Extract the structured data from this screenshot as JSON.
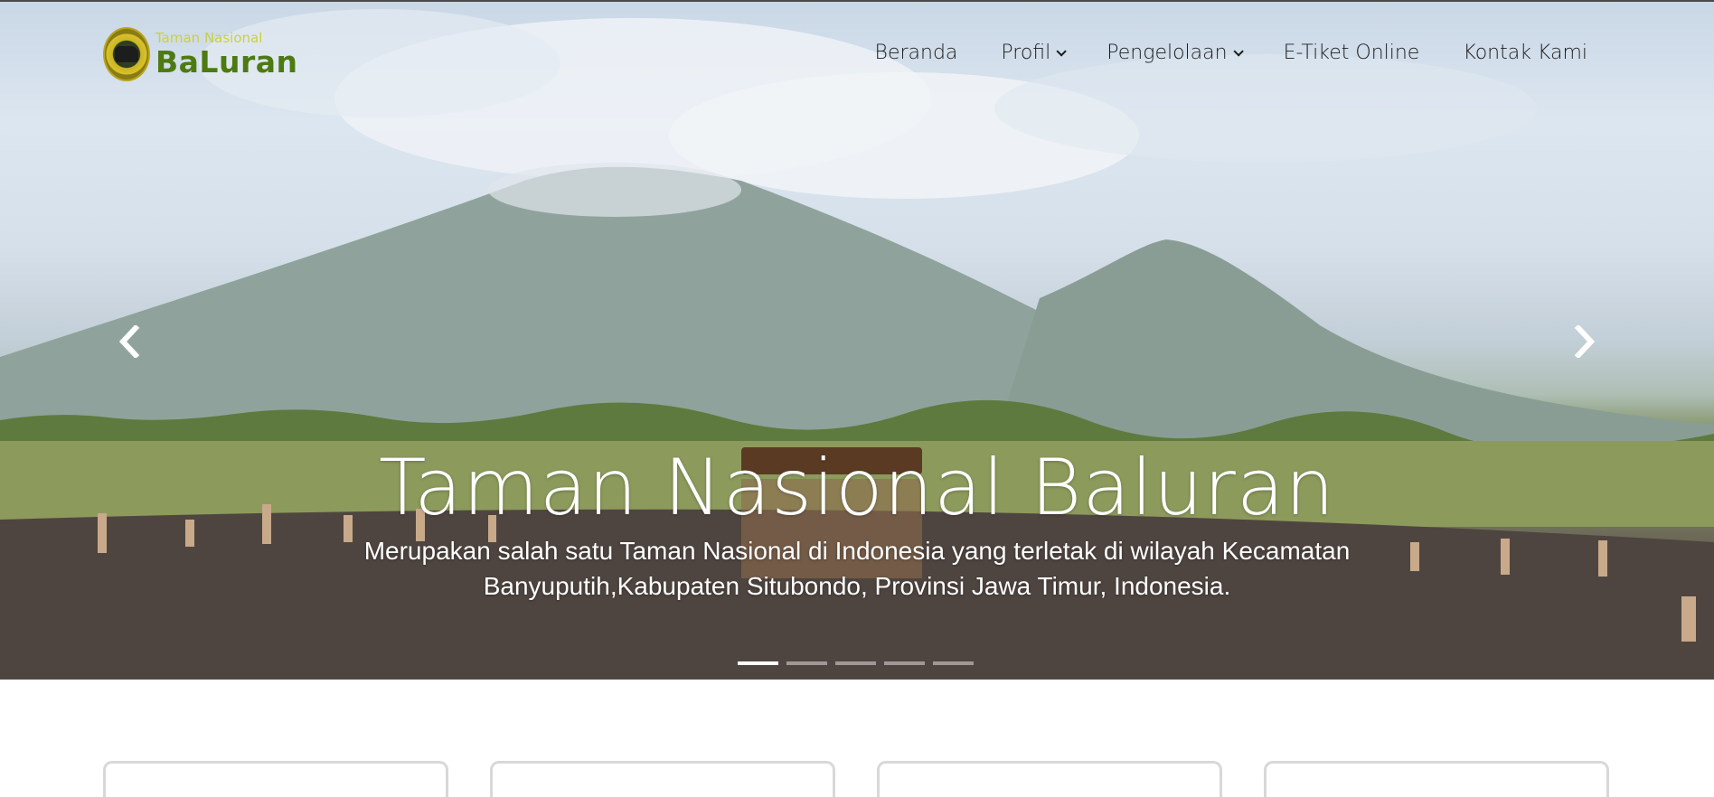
{
  "brand": {
    "top_text": "Taman Nasional",
    "main_text": "BaLuran"
  },
  "nav": {
    "items": [
      {
        "label": "Beranda",
        "dropdown": false
      },
      {
        "label": "Profil",
        "dropdown": true
      },
      {
        "label": "Pengelolaan",
        "dropdown": true
      },
      {
        "label": "E-Tiket Online",
        "dropdown": false
      },
      {
        "label": "Kontak Kami",
        "dropdown": false
      }
    ]
  },
  "hero": {
    "title": "Taman Nasional Baluran",
    "subtitle": "Merupakan salah satu Taman Nasional di Indonesia yang terletak di wilayah Kecamatan Banyuputih,Kabupaten Situbondo, Provinsi Jawa Timur, Indonesia.",
    "prev_icon": "chevron-left-icon",
    "next_icon": "chevron-right-icon",
    "slides_count": 5,
    "active_slide": 1
  },
  "colors": {
    "brand_green": "#4d7a12",
    "brand_yellow": "#c9d23a",
    "nav_text": "#1c1c1c"
  }
}
